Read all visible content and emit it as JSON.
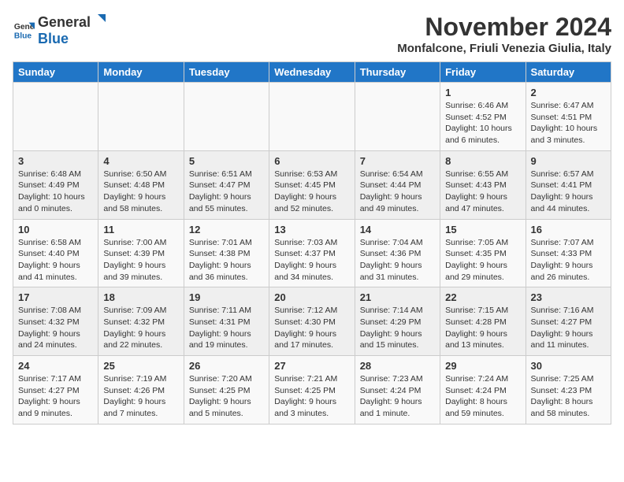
{
  "header": {
    "logo_general": "General",
    "logo_blue": "Blue",
    "month_title": "November 2024",
    "location": "Monfalcone, Friuli Venezia Giulia, Italy"
  },
  "weekdays": [
    "Sunday",
    "Monday",
    "Tuesday",
    "Wednesday",
    "Thursday",
    "Friday",
    "Saturday"
  ],
  "weeks": [
    [
      {
        "day": "",
        "info": ""
      },
      {
        "day": "",
        "info": ""
      },
      {
        "day": "",
        "info": ""
      },
      {
        "day": "",
        "info": ""
      },
      {
        "day": "",
        "info": ""
      },
      {
        "day": "1",
        "info": "Sunrise: 6:46 AM\nSunset: 4:52 PM\nDaylight: 10 hours and 6 minutes."
      },
      {
        "day": "2",
        "info": "Sunrise: 6:47 AM\nSunset: 4:51 PM\nDaylight: 10 hours and 3 minutes."
      }
    ],
    [
      {
        "day": "3",
        "info": "Sunrise: 6:48 AM\nSunset: 4:49 PM\nDaylight: 10 hours and 0 minutes."
      },
      {
        "day": "4",
        "info": "Sunrise: 6:50 AM\nSunset: 4:48 PM\nDaylight: 9 hours and 58 minutes."
      },
      {
        "day": "5",
        "info": "Sunrise: 6:51 AM\nSunset: 4:47 PM\nDaylight: 9 hours and 55 minutes."
      },
      {
        "day": "6",
        "info": "Sunrise: 6:53 AM\nSunset: 4:45 PM\nDaylight: 9 hours and 52 minutes."
      },
      {
        "day": "7",
        "info": "Sunrise: 6:54 AM\nSunset: 4:44 PM\nDaylight: 9 hours and 49 minutes."
      },
      {
        "day": "8",
        "info": "Sunrise: 6:55 AM\nSunset: 4:43 PM\nDaylight: 9 hours and 47 minutes."
      },
      {
        "day": "9",
        "info": "Sunrise: 6:57 AM\nSunset: 4:41 PM\nDaylight: 9 hours and 44 minutes."
      }
    ],
    [
      {
        "day": "10",
        "info": "Sunrise: 6:58 AM\nSunset: 4:40 PM\nDaylight: 9 hours and 41 minutes."
      },
      {
        "day": "11",
        "info": "Sunrise: 7:00 AM\nSunset: 4:39 PM\nDaylight: 9 hours and 39 minutes."
      },
      {
        "day": "12",
        "info": "Sunrise: 7:01 AM\nSunset: 4:38 PM\nDaylight: 9 hours and 36 minutes."
      },
      {
        "day": "13",
        "info": "Sunrise: 7:03 AM\nSunset: 4:37 PM\nDaylight: 9 hours and 34 minutes."
      },
      {
        "day": "14",
        "info": "Sunrise: 7:04 AM\nSunset: 4:36 PM\nDaylight: 9 hours and 31 minutes."
      },
      {
        "day": "15",
        "info": "Sunrise: 7:05 AM\nSunset: 4:35 PM\nDaylight: 9 hours and 29 minutes."
      },
      {
        "day": "16",
        "info": "Sunrise: 7:07 AM\nSunset: 4:33 PM\nDaylight: 9 hours and 26 minutes."
      }
    ],
    [
      {
        "day": "17",
        "info": "Sunrise: 7:08 AM\nSunset: 4:32 PM\nDaylight: 9 hours and 24 minutes."
      },
      {
        "day": "18",
        "info": "Sunrise: 7:09 AM\nSunset: 4:32 PM\nDaylight: 9 hours and 22 minutes."
      },
      {
        "day": "19",
        "info": "Sunrise: 7:11 AM\nSunset: 4:31 PM\nDaylight: 9 hours and 19 minutes."
      },
      {
        "day": "20",
        "info": "Sunrise: 7:12 AM\nSunset: 4:30 PM\nDaylight: 9 hours and 17 minutes."
      },
      {
        "day": "21",
        "info": "Sunrise: 7:14 AM\nSunset: 4:29 PM\nDaylight: 9 hours and 15 minutes."
      },
      {
        "day": "22",
        "info": "Sunrise: 7:15 AM\nSunset: 4:28 PM\nDaylight: 9 hours and 13 minutes."
      },
      {
        "day": "23",
        "info": "Sunrise: 7:16 AM\nSunset: 4:27 PM\nDaylight: 9 hours and 11 minutes."
      }
    ],
    [
      {
        "day": "24",
        "info": "Sunrise: 7:17 AM\nSunset: 4:27 PM\nDaylight: 9 hours and 9 minutes."
      },
      {
        "day": "25",
        "info": "Sunrise: 7:19 AM\nSunset: 4:26 PM\nDaylight: 9 hours and 7 minutes."
      },
      {
        "day": "26",
        "info": "Sunrise: 7:20 AM\nSunset: 4:25 PM\nDaylight: 9 hours and 5 minutes."
      },
      {
        "day": "27",
        "info": "Sunrise: 7:21 AM\nSunset: 4:25 PM\nDaylight: 9 hours and 3 minutes."
      },
      {
        "day": "28",
        "info": "Sunrise: 7:23 AM\nSunset: 4:24 PM\nDaylight: 9 hours and 1 minute."
      },
      {
        "day": "29",
        "info": "Sunrise: 7:24 AM\nSunset: 4:24 PM\nDaylight: 8 hours and 59 minutes."
      },
      {
        "day": "30",
        "info": "Sunrise: 7:25 AM\nSunset: 4:23 PM\nDaylight: 8 hours and 58 minutes."
      }
    ]
  ]
}
